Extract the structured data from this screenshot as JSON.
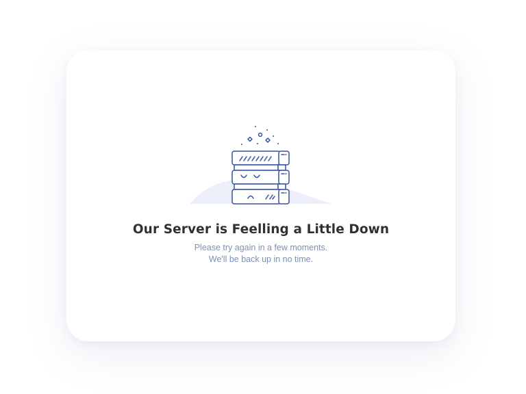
{
  "error_card": {
    "illustration_icon": "server-stack-sad-icon",
    "title": "Our Server is Feelling a Little Down",
    "message_line_1": "Please try again in a few moments.",
    "message_line_2": "We'll be back up in no time."
  },
  "colors": {
    "icon_stroke": "#3552a0",
    "icon_fill": "#ffffff",
    "ground_shape": "#eceff9",
    "title": "#2f3133",
    "message": "#7d8fb6",
    "page_background": "#ffffff",
    "card_background": "#ffffff"
  }
}
